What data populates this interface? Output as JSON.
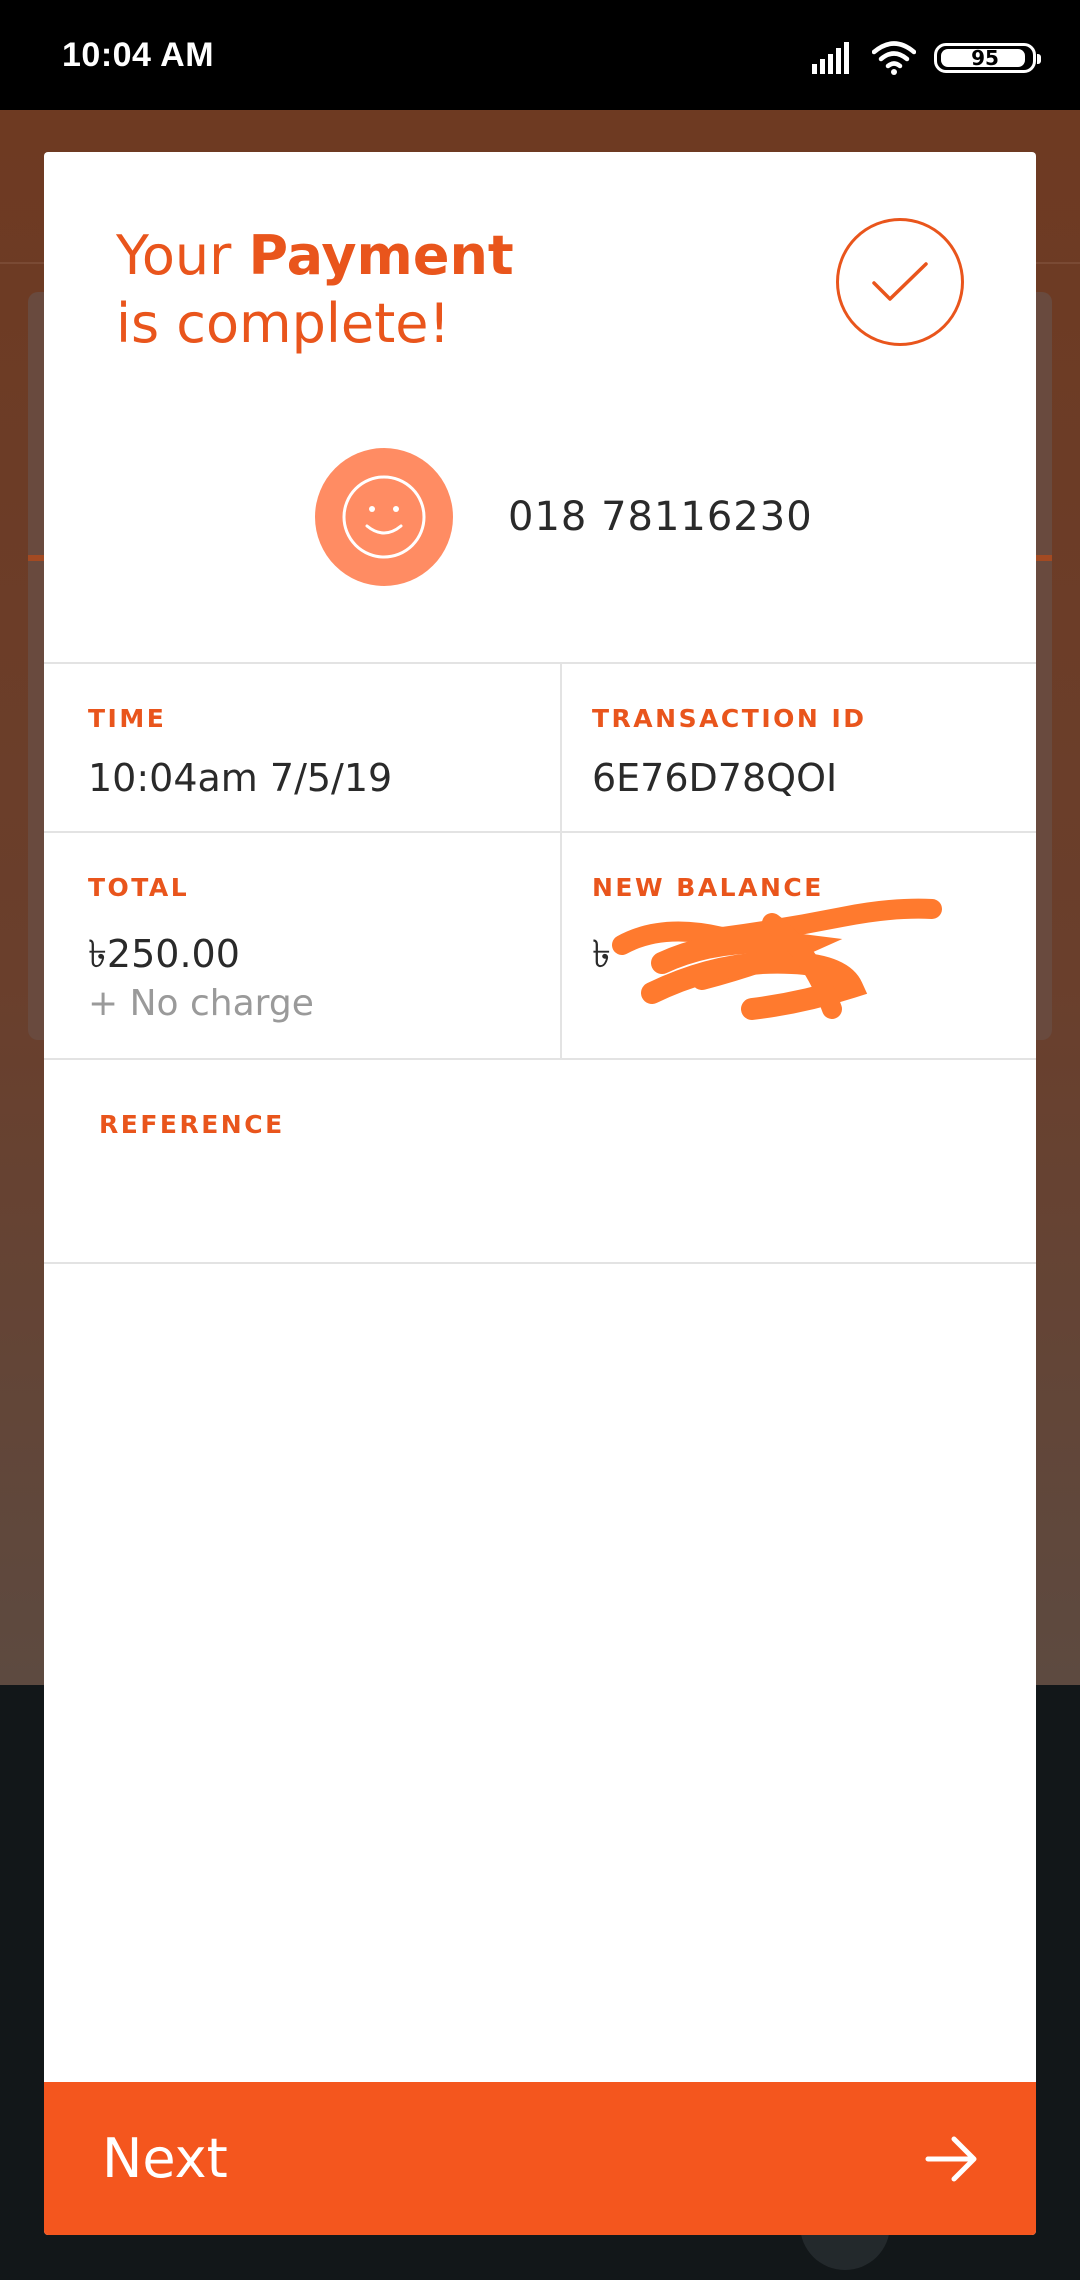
{
  "status_bar": {
    "time": "10:04 AM",
    "battery": "95",
    "battery_level_percent": 95,
    "icons": [
      "signal-icon",
      "wifi-icon",
      "battery-icon"
    ]
  },
  "colors": {
    "accent": "#e9551c",
    "button": "#f4561e",
    "avatar": "#ff8c63",
    "redaction": "#ff7a2e"
  },
  "receipt": {
    "headline_prefix": "Your",
    "headline_bold": "Payment",
    "headline_suffix": "is complete!",
    "recipient_number": "018 78116230",
    "time_label": "TIME",
    "time_value": "10:04am 7/5/19",
    "transaction_label": "TRANSACTION ID",
    "transaction_value": "6E76D78QOI",
    "total_label": "TOTAL",
    "total_value": "৳250.00",
    "total_note": "+ No charge",
    "balance_label": "NEW BALANCE",
    "balance_value_visible": "৳",
    "reference_label": "REFERENCE"
  },
  "next_button": {
    "label": "Next"
  }
}
